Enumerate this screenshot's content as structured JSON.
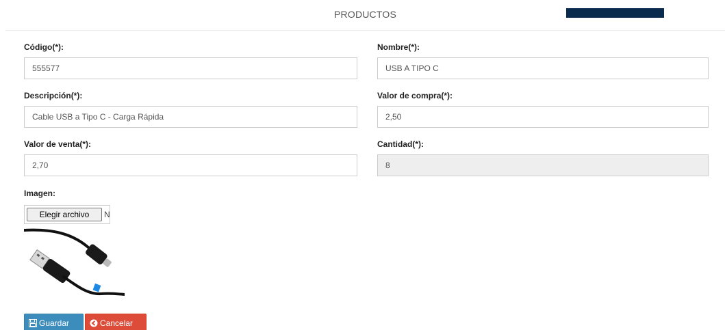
{
  "header": {
    "title": "PRODUCTOS"
  },
  "form": {
    "codigo": {
      "label": "Código(*):",
      "value": "555577"
    },
    "nombre": {
      "label": "Nombre(*):",
      "value": "USB A TIPO C"
    },
    "descripcion": {
      "label": "Descripción(*):",
      "value": "Cable USB a Tipo C - Carga Rápida"
    },
    "valor_compra": {
      "label": "Valor de compra(*):",
      "value": "2,50"
    },
    "valor_venta": {
      "label": "Valor de venta(*):",
      "value": "2,70"
    },
    "cantidad": {
      "label": "Cantidad(*):",
      "value": "8"
    },
    "imagen": {
      "label": "Imagen:",
      "choose_button": "Elegir archivo",
      "status_text": "N"
    }
  },
  "actions": {
    "save_label": "Guardar",
    "cancel_label": "Cancelar"
  },
  "icons": {
    "save": "floppy-disk-icon",
    "cancel": "circle-arrow-left-icon"
  },
  "colors": {
    "header_bar": "#0a2a4e",
    "save_button": "#3c8dbc",
    "cancel_button": "#dd4b39",
    "disabled_input": "#eeeeee"
  }
}
